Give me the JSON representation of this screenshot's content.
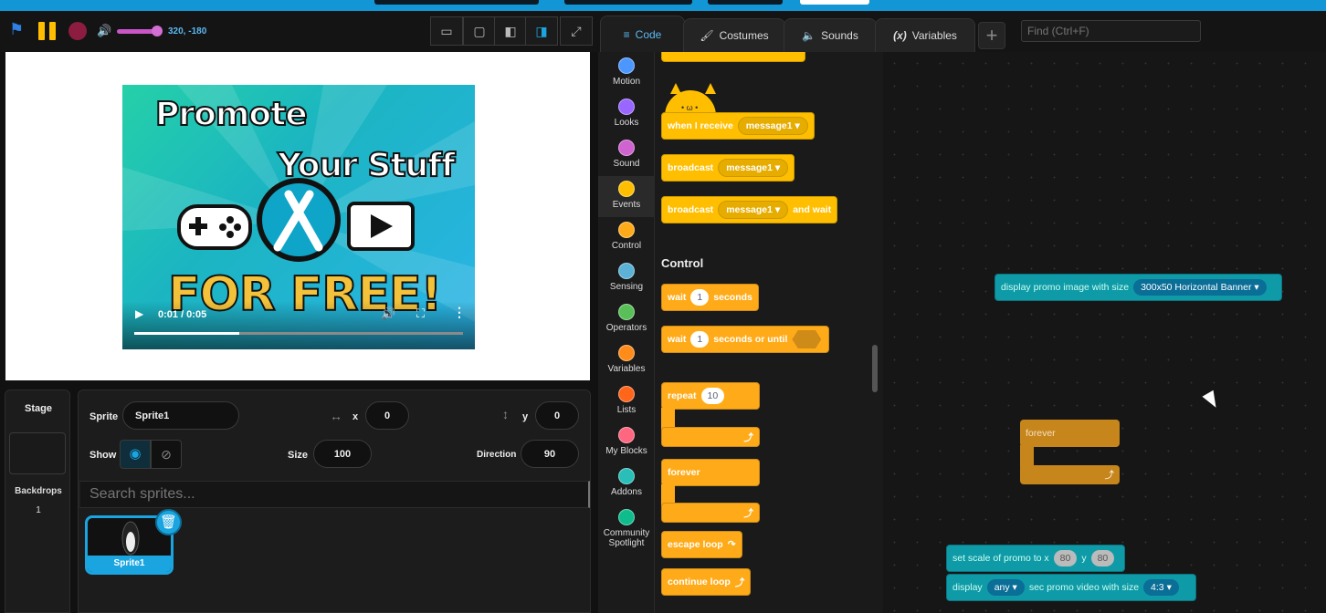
{
  "toolbar": {
    "coords": "320, -180"
  },
  "video": {
    "title_line1": "Promote",
    "title_line2": "Your Stuff",
    "title_line3": "FOR FREE!",
    "time": "0:01 / 0:05",
    "progress": 0.32
  },
  "stage_panel": {
    "label": "Stage",
    "backdrops_label": "Backdrops",
    "backdrops_count": "1"
  },
  "sprite_info": {
    "sprite_label": "Sprite",
    "sprite_name": "Sprite1",
    "x_label": "x",
    "x_value": "0",
    "y_label": "y",
    "y_value": "0",
    "show_label": "Show",
    "size_label": "Size",
    "size_value": "100",
    "direction_label": "Direction",
    "direction_value": "90"
  },
  "sprite_search": {
    "placeholder": "Search sprites..."
  },
  "sprites": [
    {
      "name": "Sprite1"
    }
  ],
  "tabs": {
    "code": "Code",
    "costumes": "Costumes",
    "sounds": "Sounds",
    "variables": "Variables"
  },
  "find": {
    "placeholder": "Find (Ctrl+F)"
  },
  "categories": [
    {
      "label": "Motion",
      "color": "#4c97ff"
    },
    {
      "label": "Looks",
      "color": "#9966ff"
    },
    {
      "label": "Sound",
      "color": "#cf63cf"
    },
    {
      "label": "Events",
      "color": "#ffbf00"
    },
    {
      "label": "Control",
      "color": "#ffab19"
    },
    {
      "label": "Sensing",
      "color": "#5cb1d6"
    },
    {
      "label": "Operators",
      "color": "#59c059"
    },
    {
      "label": "Variables",
      "color": "#ff8c1a"
    },
    {
      "label": "Lists",
      "color": "#ff661a"
    },
    {
      "label": "My Blocks",
      "color": "#ff6680"
    },
    {
      "label": "Addons",
      "color": "#29beb8"
    },
    {
      "label": "Community Spotlight",
      "color": "#0fbd8c"
    }
  ],
  "palette": {
    "when_receive": "when I receive",
    "message1": "message1",
    "broadcast": "broadcast",
    "and_wait": "and wait",
    "control_heading": "Control",
    "wait": "wait",
    "wait_val": "1",
    "seconds": "seconds",
    "seconds_until": "seconds or until",
    "repeat": "repeat",
    "repeat_val": "10",
    "forever": "forever",
    "escape_loop": "escape loop",
    "continue_loop": "continue loop"
  },
  "workspace": {
    "display_image": "display promo image with size",
    "banner": "300x50 Horizontal Banner",
    "forever": "forever",
    "set_scale": "set scale of promo to x",
    "scale_x": "80",
    "y": "y",
    "scale_y": "80",
    "display": "display",
    "any": "any",
    "sec_video": "sec promo video with size",
    "ratio": "4:3"
  }
}
